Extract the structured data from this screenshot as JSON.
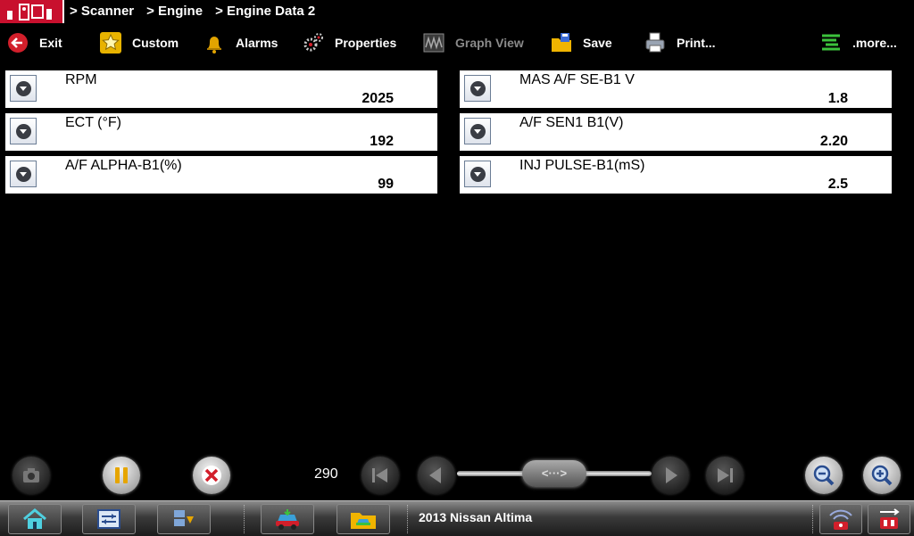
{
  "header": {
    "breadcrumb": [
      "> Scanner",
      "> Engine",
      "> Engine Data 2"
    ]
  },
  "toolbar": {
    "exit": "Exit",
    "custom": "Custom",
    "alarms": "Alarms",
    "properties": "Properties",
    "graph_view": "Graph View",
    "save": "Save",
    "print": "Print...",
    "more": ".more..."
  },
  "pids": [
    {
      "label": "RPM",
      "value": "2025"
    },
    {
      "label": "MAS A/F SE-B1 V",
      "value": "1.8"
    },
    {
      "label": "ECT (°F)",
      "value": "192"
    },
    {
      "label": "A/F SEN1 B1(V)",
      "value": "2.20"
    },
    {
      "label": "A/F ALPHA-B1(%)",
      "value": "99"
    },
    {
      "label": "INJ PULSE-B1(mS)",
      "value": "2.5"
    }
  ],
  "playback": {
    "frame": "290",
    "slider_thumb": "<···>"
  },
  "taskbar": {
    "vehicle": "2013 Nissan Altima"
  },
  "colors": {
    "brand": "#c8102e",
    "background": "#000000",
    "card": "#ffffff",
    "disabled": "#8a8a8a"
  }
}
